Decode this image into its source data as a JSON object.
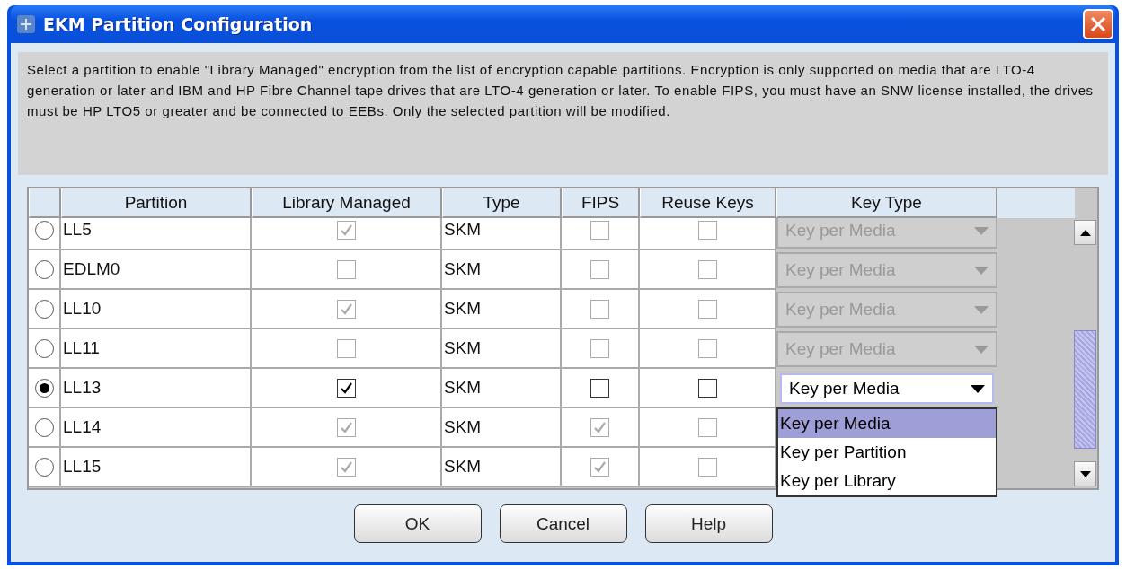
{
  "window": {
    "title": "EKM Partition Configuration"
  },
  "description": "Select a partition to enable \"Library Managed\" encryption from the list of encryption capable partitions. Encryption is only supported on media that are LTO-4 generation or later and IBM and HP Fibre Channel tape drives that are LTO-4 generation or later. To enable FIPS, you must have an SNW license installed, the drives must be HP LTO5 or greater and be connected to EEBs. Only the selected partition will be modified.",
  "table": {
    "columns": [
      "Partition",
      "Library Managed",
      "Type",
      "FIPS",
      "Reuse Keys",
      "Key Type"
    ],
    "rows": [
      {
        "selected": false,
        "partition": "LL5",
        "library_managed": true,
        "type": "SKM",
        "fips": false,
        "reuse_keys": false,
        "key_type": "Key per Media",
        "disabled": true
      },
      {
        "selected": false,
        "partition": "EDLM0",
        "library_managed": false,
        "type": "SKM",
        "fips": false,
        "reuse_keys": false,
        "key_type": "Key per Media",
        "disabled": true
      },
      {
        "selected": false,
        "partition": "LL10",
        "library_managed": true,
        "type": "SKM",
        "fips": false,
        "reuse_keys": false,
        "key_type": "Key per Media",
        "disabled": true
      },
      {
        "selected": false,
        "partition": "LL11",
        "library_managed": false,
        "type": "SKM",
        "fips": false,
        "reuse_keys": false,
        "key_type": "Key per Media",
        "disabled": true
      },
      {
        "selected": true,
        "partition": "LL13",
        "library_managed": true,
        "type": "SKM",
        "fips": false,
        "reuse_keys": false,
        "key_type": "Key per Media",
        "disabled": false
      },
      {
        "selected": false,
        "partition": "LL14",
        "library_managed": true,
        "type": "SKM",
        "fips": true,
        "reuse_keys": false,
        "disabled": true
      },
      {
        "selected": false,
        "partition": "LL15",
        "library_managed": true,
        "type": "SKM",
        "fips": true,
        "reuse_keys": false,
        "disabled": true
      }
    ]
  },
  "key_type_menu": {
    "options": [
      {
        "label": "Key per Media",
        "selected": true
      },
      {
        "label": "Key per Partition",
        "selected": false
      },
      {
        "label": "Key per Library",
        "selected": false
      }
    ]
  },
  "buttons": [
    "OK",
    "Cancel",
    "Help"
  ]
}
